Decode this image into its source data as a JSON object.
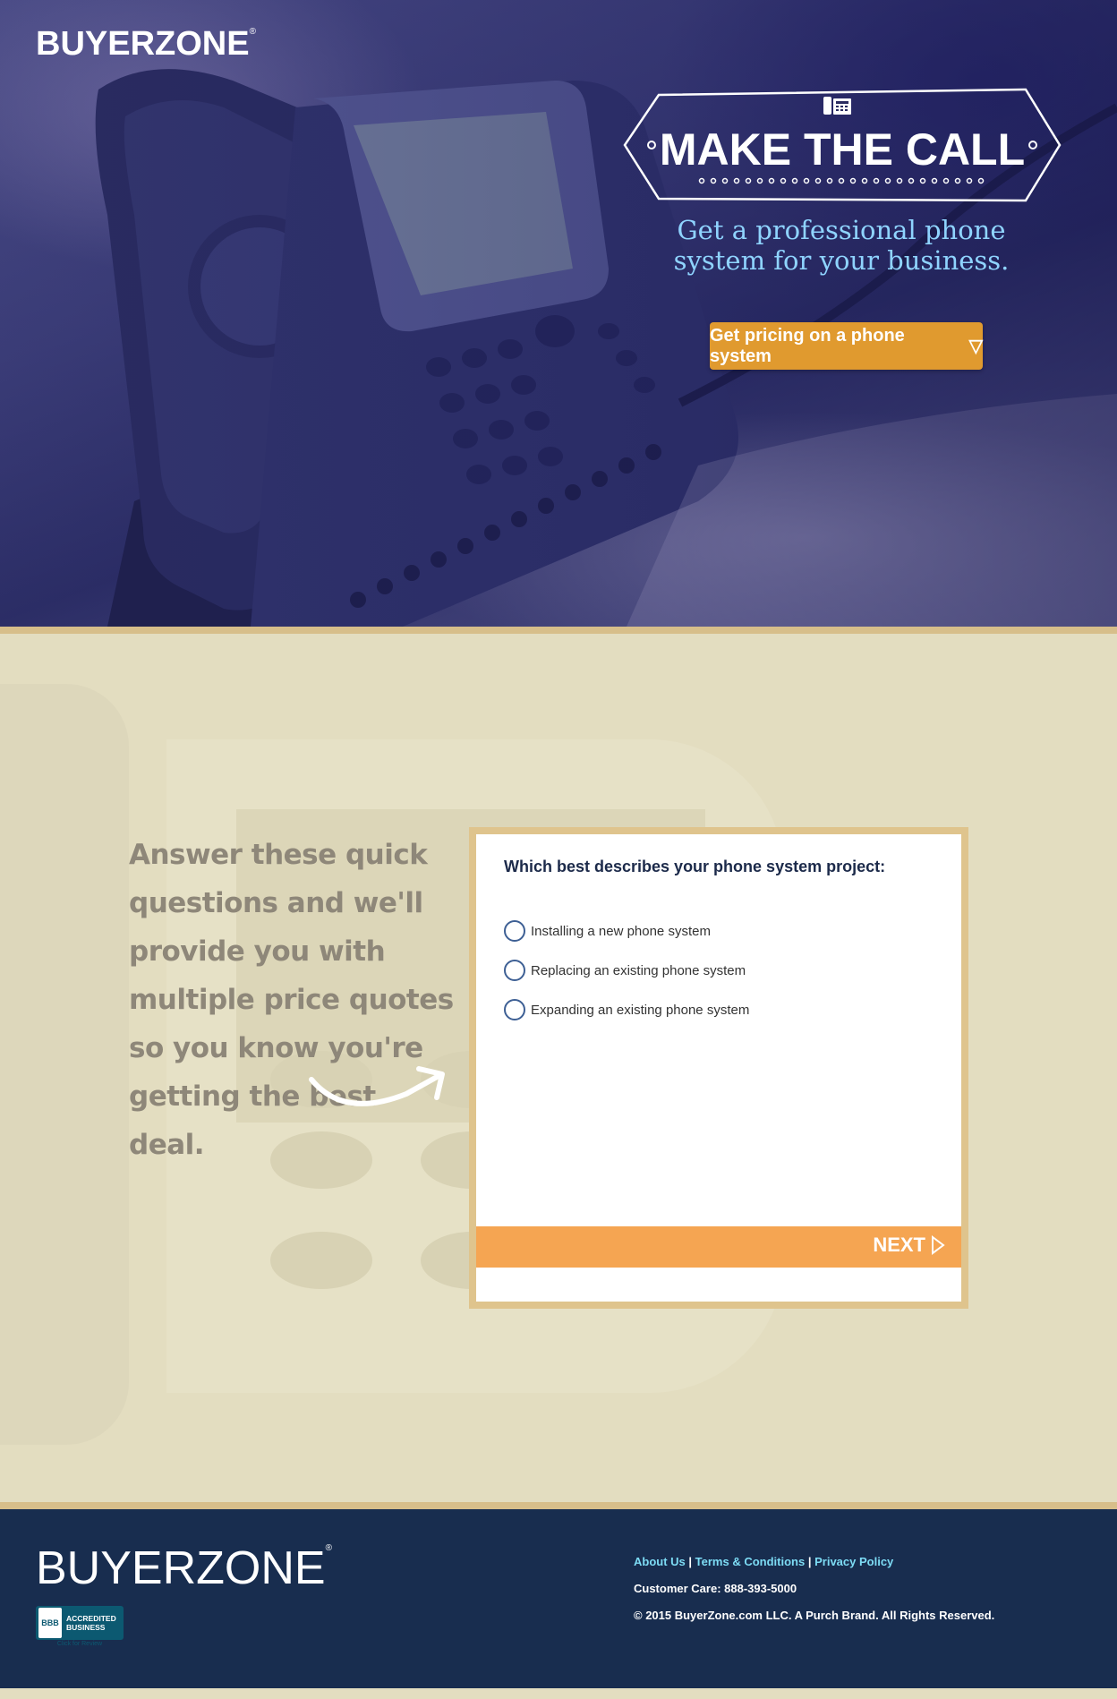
{
  "header": {
    "logo_text": "BUYERZONE",
    "registered_mark": "®"
  },
  "hero": {
    "badge_title": "MAKE THE CALL",
    "subtitle_line1": "Get a professional phone",
    "subtitle_line2": "system for your business.",
    "cta_label": "Get pricing on a phone system",
    "cta_icon": "▽"
  },
  "pitch": {
    "text": "Answer these quick questions and we'll provide you with multiple price quotes so you know you're getting the best deal."
  },
  "quiz": {
    "question": "Which best describes your phone system project:",
    "options": [
      {
        "label": "Installing a new phone system"
      },
      {
        "label": "Replacing an existing phone system"
      },
      {
        "label": "Expanding an existing phone system"
      }
    ],
    "next_label": "NEXT"
  },
  "footer": {
    "logo_text": "BUYERZONE",
    "registered_mark": "®",
    "bbb_seal": "BBB",
    "bbb_line1": "ACCREDITED",
    "bbb_line2": "BUSINESS",
    "bbb_click": "Click for Review",
    "links": {
      "about": "About Us",
      "terms": "Terms & Conditions",
      "privacy": "Privacy Policy",
      "separator": "|"
    },
    "customer_care": "Customer Care: 888-393-5000",
    "copyright": "© 2015 BuyerZone.com LLC. A Purch Brand. All Rights Reserved."
  },
  "colors": {
    "cta": "#e09a2f",
    "next_bar": "#f5a552",
    "footer_bg": "#182d4f",
    "link": "#7ddcf5",
    "subtitle": "#8fd4ff",
    "card_border": "#dfc48d"
  }
}
